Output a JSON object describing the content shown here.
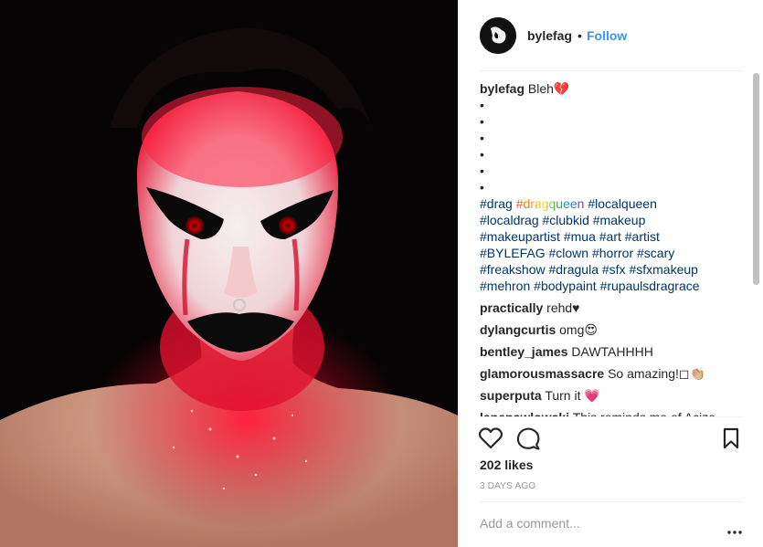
{
  "post": {
    "username": "bylefag",
    "follow_label": "Follow",
    "separator": "•"
  },
  "caption": {
    "username": "bylefag",
    "text": "Bleh💔",
    "bullets": [
      "•",
      "•",
      "•",
      "•",
      "•",
      "•"
    ],
    "hashtag_lines": [
      [
        "#drag",
        "#dragqueen",
        "#localqueen"
      ],
      [
        "#localdrag",
        "#clubkid",
        "#makeup"
      ],
      [
        "#makeupartist",
        "#mua",
        "#art",
        "#artist"
      ],
      [
        "#BYLEFAG",
        "#clown",
        "#horror",
        "#scary"
      ],
      [
        "#freakshow",
        "#dragula",
        "#sfx",
        "#sfxmakeup"
      ],
      [
        "#mehron",
        "#bodypaint",
        "#rupaulsdragrace"
      ]
    ]
  },
  "comments": [
    {
      "username": "practically",
      "text": "rehd♥"
    },
    {
      "username": "dylangcurtis",
      "text": "omg😍"
    },
    {
      "username": "bentley_james",
      "text": "DAWTAHHHH"
    },
    {
      "username": "glamorousmassacre",
      "text": "So amazing!◻👏🏼"
    },
    {
      "username": "superputa",
      "text": "Turn it 💗"
    },
    {
      "username": "lanepawlowski",
      "text": "This reminds me of Acize"
    }
  ],
  "actions": {
    "likes": "202 likes",
    "date": "3 DAYS AGO"
  },
  "comment_box": {
    "placeholder": "Add a comment..."
  },
  "icons": {
    "like": "heart-icon",
    "comment": "comment-bubble-icon",
    "save": "bookmark-icon",
    "more": "more-options-icon"
  },
  "colors": {
    "link": "#3897f0",
    "hashtag": "#003569",
    "muted": "#999999"
  }
}
